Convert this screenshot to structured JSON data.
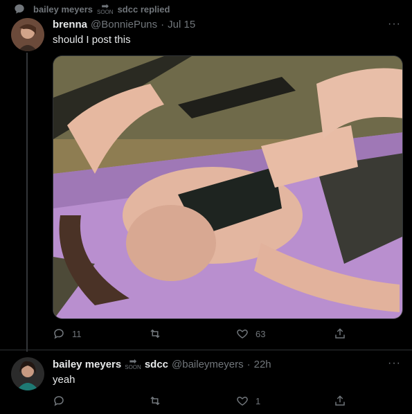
{
  "social_context": {
    "replier": "bailey meyers",
    "soon_badge": "SOON",
    "rest": "sdcc replied"
  },
  "tweet1": {
    "name": "brenna",
    "handle": "@BonniePuns",
    "dot": "·",
    "time": "Jul 15",
    "text": "should I post this",
    "more": "···",
    "reply_count": "11",
    "retweet_count": "",
    "like_count": "63"
  },
  "tweet2": {
    "name": "bailey meyers",
    "soon_badge": "SOON",
    "name_suffix": "sdcc",
    "handle": "@baileymeyers",
    "dot": "·",
    "time": "22h",
    "text": "yeah",
    "more": "···",
    "reply_count": "",
    "retweet_count": "",
    "like_count": "1"
  },
  "colors": {
    "background": "#000000",
    "text_primary": "#e7e9ea",
    "text_secondary": "#71767b",
    "border": "#2f3336"
  },
  "icons": [
    "speech-bubble-icon",
    "reply-icon",
    "retweet-icon",
    "like-icon",
    "share-icon",
    "more-icon",
    "soon-arrow-icon"
  ]
}
